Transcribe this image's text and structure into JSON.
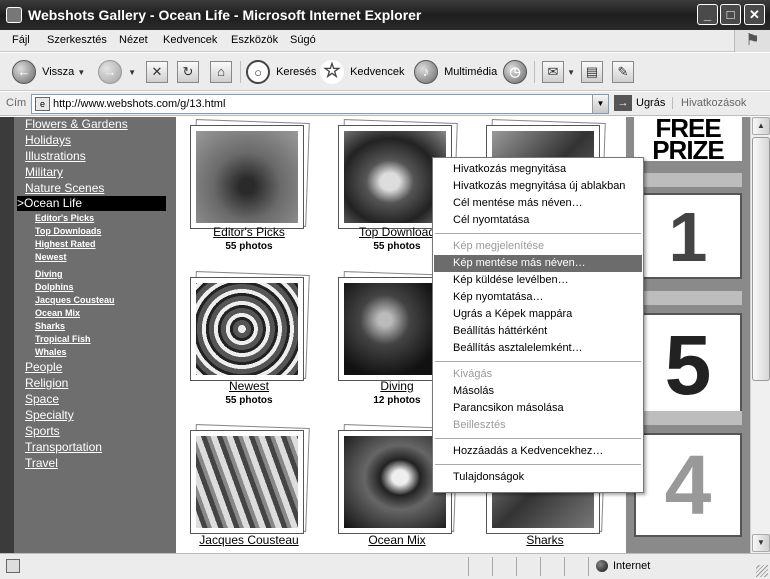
{
  "window": {
    "title": "Webshots Gallery - Ocean Life - Microsoft Internet Explorer",
    "controls": [
      "_",
      "□",
      "✕"
    ]
  },
  "menu": [
    "Fájl",
    "Szerkesztés",
    "Nézet",
    "Kedvencek",
    "Eszközök",
    "Súgó"
  ],
  "toolbar": {
    "back": "Vissza",
    "search": "Keresés",
    "favorites": "Kedvencek",
    "media": "Multimédia"
  },
  "address": {
    "label": "Cím",
    "url": "http://www.webshots.com/g/13.html",
    "go": "Ugrás",
    "links": "Hivatkozások"
  },
  "sidebar": {
    "categories": [
      "Flowers & Gardens",
      "Holidays",
      "Illustrations",
      "Military",
      "Nature Scenes"
    ],
    "active": ">Ocean Life",
    "subcategories": [
      "Editor's Picks",
      "Top Downloads",
      "Highest Rated",
      "Newest",
      "Diving",
      "Dolphins",
      "Jacques Cousteau",
      "Ocean Mix",
      "Sharks",
      "Tropical Fish",
      "Whales"
    ],
    "more_categories": [
      "People",
      "Religion",
      "Space",
      "Specialty",
      "Sports",
      "Transportation",
      "Travel"
    ]
  },
  "gallery": [
    {
      "title": "Editor's Picks",
      "count": "55 photos"
    },
    {
      "title": "Top Download",
      "count": "55 photos"
    },
    {
      "title": "Newest",
      "count": "55 photos"
    },
    {
      "title": "Diving",
      "count": "12 photos"
    },
    {
      "title": "Jacques Cousteau",
      "count": ""
    },
    {
      "title": "Ocean Mix",
      "count": ""
    },
    {
      "title": "Sharks",
      "count": ""
    }
  ],
  "ad": {
    "headline": "FREE PRIZE",
    "numbers": [
      "1",
      "5",
      "4"
    ]
  },
  "context_menu": {
    "group1": [
      "Hivatkozás megnyitása",
      "Hivatkozás megnyitása új ablakban",
      "Cél mentése más néven…",
      "Cél nyomtatása"
    ],
    "group2": [
      "Kép megjelenítése",
      "Kép mentése más néven…",
      "Kép küldése levélben…",
      "Kép nyomtatása…",
      "Ugrás a Képek mappára",
      "Beállítás háttérként",
      "Beállítás asztalelemként…"
    ],
    "group3": [
      "Kivágás",
      "Másolás",
      "Parancsikon másolása",
      "Beillesztés"
    ],
    "group4": [
      "Hozzáadás a Kedvencekhez…"
    ],
    "group5": [
      "Tulajdonságok"
    ]
  },
  "status": {
    "zone": "Internet"
  }
}
